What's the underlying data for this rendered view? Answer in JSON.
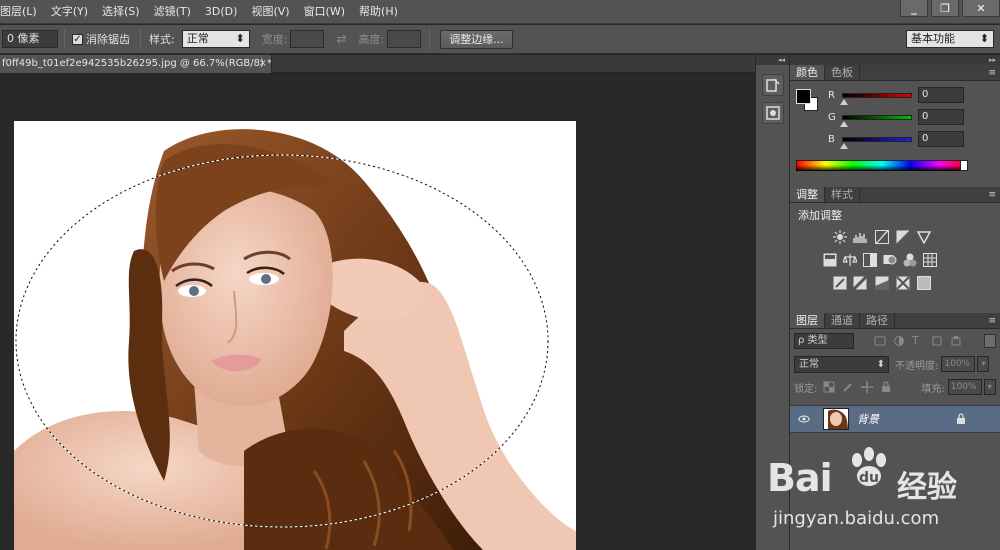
{
  "menubar": {
    "items": [
      "图层(L)",
      "文字(Y)",
      "选择(S)",
      "滤镜(T)",
      "3D(D)",
      "视图(V)",
      "窗口(W)",
      "帮助(H)"
    ],
    "minimize": "_",
    "restore": "❐",
    "close": "✕"
  },
  "options": {
    "feather_value": "0 像素",
    "antialias_label": "消除锯齿",
    "antialias_checked": true,
    "style_label": "样式:",
    "style_value": "正常",
    "width_label": "宽度:",
    "height_label": "高度:",
    "refine_edge_button": "调整边缘...",
    "workspace_value": "基本功能"
  },
  "document": {
    "tab_title": "f0ff49b_t01ef2e942535b26295.jpg @ 66.7%(RGB/8) *",
    "tab_close": "×"
  },
  "color_panel": {
    "tabs": [
      "颜色",
      "色板"
    ],
    "channels": [
      {
        "label": "R",
        "value": "0",
        "color": "#d40000"
      },
      {
        "label": "G",
        "value": "0",
        "color": "#00a000"
      },
      {
        "label": "B",
        "value": "0",
        "color": "#1a1acc"
      }
    ],
    "foreground": "#000000",
    "background": "#ffffff"
  },
  "adjustments_panel": {
    "tabs": [
      "调整",
      "样式"
    ],
    "title": "添加调整",
    "icons_row1": [
      "brightness-icon",
      "levels-icon",
      "curves-icon",
      "exposure-icon",
      "vibrance-icon"
    ],
    "icons_row2": [
      "hue-saturation-icon",
      "color-balance-icon",
      "black-white-icon",
      "photo-filter-icon",
      "channel-mixer-icon",
      "color-lookup-icon"
    ],
    "icons_row3": [
      "invert-icon",
      "posterize-icon",
      "threshold-icon",
      "selective-color-icon",
      "gradient-map-icon"
    ]
  },
  "layers_panel": {
    "tabs": [
      "图层",
      "通道",
      "路径"
    ],
    "filter_label": "ρ 类型",
    "blend_mode": "正常",
    "opacity_label": "不透明度:",
    "opacity_value": "100%",
    "lock_label": "锁定:",
    "fill_label": "填充:",
    "fill_value": "100%",
    "layer_name": "背景"
  },
  "watermark": {
    "brand": "Bai",
    "brand_cn": "经验",
    "url": "jingyan.baidu.com"
  }
}
